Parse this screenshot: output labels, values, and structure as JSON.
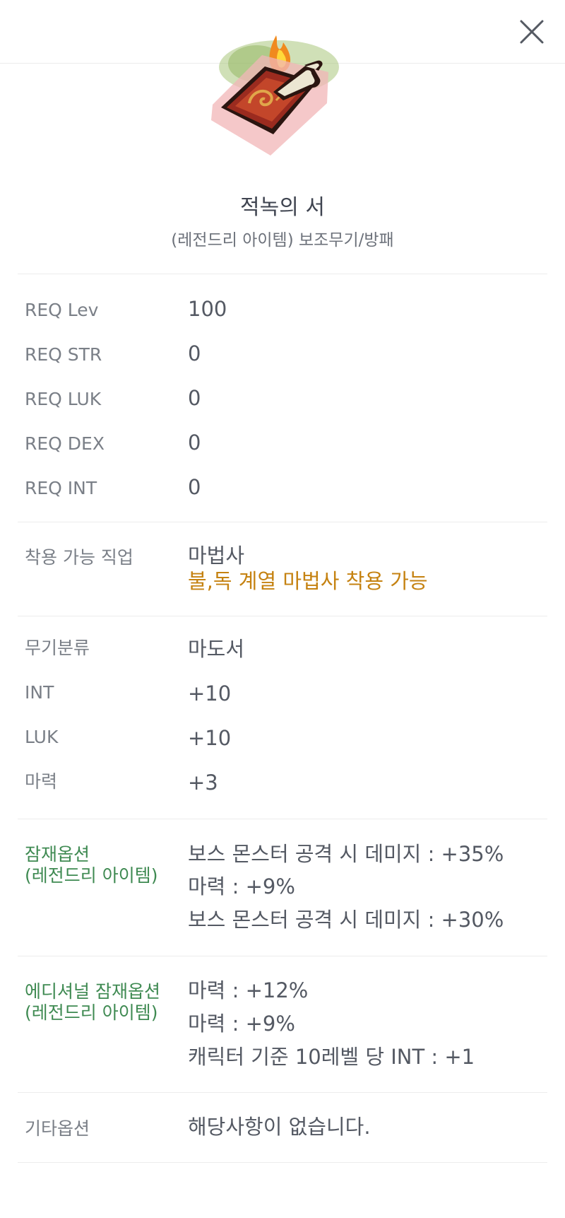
{
  "header": {
    "close_icon": "close-icon"
  },
  "item": {
    "image_icon": "red-poison-book-item-icon",
    "name": "적녹의 서",
    "subtitle": "(레전드리 아이템) 보조무기/방패"
  },
  "requirements": [
    {
      "label": "REQ Lev",
      "value": "100"
    },
    {
      "label": "REQ STR",
      "value": "0"
    },
    {
      "label": "REQ LUK",
      "value": "0"
    },
    {
      "label": "REQ DEX",
      "value": "0"
    },
    {
      "label": "REQ INT",
      "value": "0"
    }
  ],
  "job": {
    "label": "착용 가능 직업",
    "value": "마법사",
    "note": "불,독 계열 마법사 착용 가능",
    "note_color": "#c58211"
  },
  "stats": [
    {
      "label": "무기분류",
      "value": "마도서"
    },
    {
      "label": "INT",
      "value": "+10"
    },
    {
      "label": "LUK",
      "value": "+10"
    },
    {
      "label": "마력",
      "value": "+3"
    }
  ],
  "potential": {
    "label_line1": "잠재옵션",
    "label_line2": "(레전드리 아이템)",
    "label_color": "#3f8a52",
    "lines": [
      "보스 몬스터 공격 시 데미지 : +35%",
      "마력 : +9%",
      "보스 몬스터 공격 시 데미지 : +30%"
    ]
  },
  "additional_potential": {
    "label_line1": "에디셔널 잠재옵션",
    "label_line2": "(레전드리 아이템)",
    "lines": [
      "마력 : +12%",
      "마력 : +9%",
      "캐릭터 기준 10레벨 당 INT : +1"
    ]
  },
  "other": {
    "label": "기타옵션",
    "value": "해당사항이 없습니다."
  }
}
